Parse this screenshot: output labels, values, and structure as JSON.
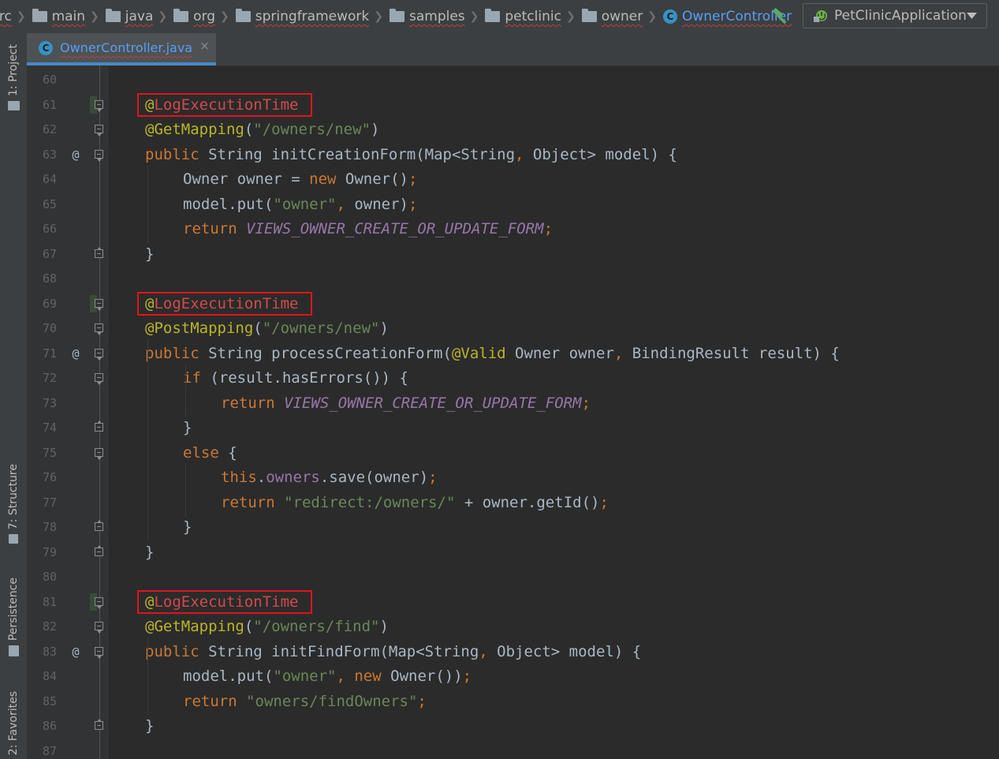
{
  "breadcrumb": {
    "items": [
      {
        "label": "src",
        "icon": "folder-icon"
      },
      {
        "label": "main",
        "icon": "folder-icon"
      },
      {
        "label": "java",
        "icon": "folder-icon"
      },
      {
        "label": "org",
        "icon": "package-icon"
      },
      {
        "label": "springframework",
        "icon": "package-icon"
      },
      {
        "label": "samples",
        "icon": "package-icon"
      },
      {
        "label": "petclinic",
        "icon": "package-icon"
      },
      {
        "label": "owner",
        "icon": "package-icon"
      },
      {
        "label": "OwnerController",
        "icon": "class-icon"
      }
    ],
    "separator": "❯"
  },
  "toolbar": {
    "build_icon": "hammer-icon",
    "run_config": "PetClinicApplication",
    "run_config_icon": "spring-boot-icon"
  },
  "tool_windows": {
    "project": "1: Project",
    "structure": "7: Structure",
    "persistence": "Persistence",
    "favorites": "2: Favorites"
  },
  "editor": {
    "tab_label": "OwnerController.java",
    "tab_icon_letter": "C",
    "tab_close": "×",
    "highlight_color": "#e0141e",
    "lines": [
      {
        "n": "60",
        "tokens": []
      },
      {
        "n": "61",
        "boxed": true,
        "tokens": [
          [
            "@",
            "t-ann"
          ],
          [
            "LogExecutionTime",
            "t-red"
          ]
        ]
      },
      {
        "n": "62",
        "tokens": [
          [
            "@GetMapping",
            "t-ann"
          ],
          [
            "(",
            "t-def"
          ],
          [
            "\"/owners/new\"",
            "t-str"
          ],
          [
            ")",
            "t-def"
          ]
        ]
      },
      {
        "n": "63",
        "override": "@",
        "tokens": [
          [
            "public ",
            "t-kw"
          ],
          [
            "String ",
            "t-def"
          ],
          [
            "initCreationForm",
            "t-def"
          ],
          [
            "(Map<String",
            "t-def"
          ],
          [
            ", ",
            "t-sym"
          ],
          [
            "Object> model) {",
            "t-def"
          ]
        ]
      },
      {
        "n": "64",
        "tokens": [
          [
            "Owner owner = ",
            "t-def"
          ],
          [
            "new ",
            "t-kw"
          ],
          [
            "Owner()",
            "t-def"
          ],
          [
            ";",
            "t-sym"
          ]
        ]
      },
      {
        "n": "65",
        "tokens": [
          [
            "model.put(",
            "t-def"
          ],
          [
            "\"owner\"",
            "t-str"
          ],
          [
            ", ",
            "t-sym"
          ],
          [
            "owner)",
            "t-def"
          ],
          [
            ";",
            "t-sym"
          ]
        ]
      },
      {
        "n": "66",
        "tokens": [
          [
            "return ",
            "t-kw"
          ],
          [
            "VIEWS_OWNER_CREATE_OR_UPDATE_FORM",
            "t-const"
          ],
          [
            ";",
            "t-sym"
          ]
        ]
      },
      {
        "n": "67",
        "tokens": [
          [
            "}",
            "t-def"
          ]
        ]
      },
      {
        "n": "68",
        "tokens": []
      },
      {
        "n": "69",
        "boxed": true,
        "tokens": [
          [
            "@",
            "t-ann"
          ],
          [
            "LogExecutionTime",
            "t-red"
          ]
        ]
      },
      {
        "n": "70",
        "tokens": [
          [
            "@PostMapping",
            "t-ann"
          ],
          [
            "(",
            "t-def"
          ],
          [
            "\"/owners/new\"",
            "t-str"
          ],
          [
            ")",
            "t-def"
          ]
        ]
      },
      {
        "n": "71",
        "override": "@",
        "tokens": [
          [
            "public ",
            "t-kw"
          ],
          [
            "String ",
            "t-def"
          ],
          [
            "processCreationForm",
            "t-def"
          ],
          [
            "(",
            "t-def"
          ],
          [
            "@Valid ",
            "t-ann"
          ],
          [
            "Owner owner",
            "t-def"
          ],
          [
            ", ",
            "t-sym"
          ],
          [
            "BindingResult result) {",
            "t-def"
          ]
        ]
      },
      {
        "n": "72",
        "tokens": [
          [
            "if ",
            "t-kw"
          ],
          [
            "(result.hasErrors()) {",
            "t-def"
          ]
        ]
      },
      {
        "n": "73",
        "tokens": [
          [
            "return ",
            "t-kw"
          ],
          [
            "VIEWS_OWNER_CREATE_OR_UPDATE_FORM",
            "t-const"
          ],
          [
            ";",
            "t-sym"
          ]
        ]
      },
      {
        "n": "74",
        "tokens": [
          [
            "}",
            "t-def"
          ]
        ]
      },
      {
        "n": "75",
        "tokens": [
          [
            "else ",
            "t-kw"
          ],
          [
            "{",
            "t-def"
          ]
        ]
      },
      {
        "n": "76",
        "tokens": [
          [
            "this",
            "t-kw"
          ],
          [
            ".",
            "t-def"
          ],
          [
            "owners",
            "t-field"
          ],
          [
            ".save(owner)",
            "t-def"
          ],
          [
            ";",
            "t-sym"
          ]
        ]
      },
      {
        "n": "77",
        "tokens": [
          [
            "return ",
            "t-kw"
          ],
          [
            "\"redirect:/owners/\"",
            "t-str"
          ],
          [
            " + owner.getId()",
            "t-def"
          ],
          [
            ";",
            "t-sym"
          ]
        ]
      },
      {
        "n": "78",
        "tokens": [
          [
            "}",
            "t-def"
          ]
        ]
      },
      {
        "n": "79",
        "tokens": [
          [
            "}",
            "t-def"
          ]
        ]
      },
      {
        "n": "80",
        "tokens": []
      },
      {
        "n": "81",
        "boxed": true,
        "tokens": [
          [
            "@",
            "t-ann"
          ],
          [
            "LogExecutionTime",
            "t-red"
          ]
        ]
      },
      {
        "n": "82",
        "tokens": [
          [
            "@GetMapping",
            "t-ann"
          ],
          [
            "(",
            "t-def"
          ],
          [
            "\"/owners/find\"",
            "t-str"
          ],
          [
            ")",
            "t-def"
          ]
        ]
      },
      {
        "n": "83",
        "override": "@",
        "tokens": [
          [
            "public ",
            "t-kw"
          ],
          [
            "String ",
            "t-def"
          ],
          [
            "initFindForm",
            "t-def"
          ],
          [
            "(Map<String",
            "t-def"
          ],
          [
            ", ",
            "t-sym"
          ],
          [
            "Object> model) {",
            "t-def"
          ]
        ]
      },
      {
        "n": "84",
        "tokens": [
          [
            "model.put(",
            "t-def"
          ],
          [
            "\"owner\"",
            "t-str"
          ],
          [
            ", ",
            "t-sym"
          ],
          [
            "new ",
            "t-kw"
          ],
          [
            "Owner())",
            "t-def"
          ],
          [
            ";",
            "t-sym"
          ]
        ]
      },
      {
        "n": "85",
        "tokens": [
          [
            "return ",
            "t-kw"
          ],
          [
            "\"owners/findOwners\"",
            "t-str"
          ],
          [
            ";",
            "t-sym"
          ]
        ]
      },
      {
        "n": "86",
        "tokens": [
          [
            "}",
            "t-def"
          ]
        ]
      },
      {
        "n": "87",
        "tokens": []
      }
    ]
  }
}
